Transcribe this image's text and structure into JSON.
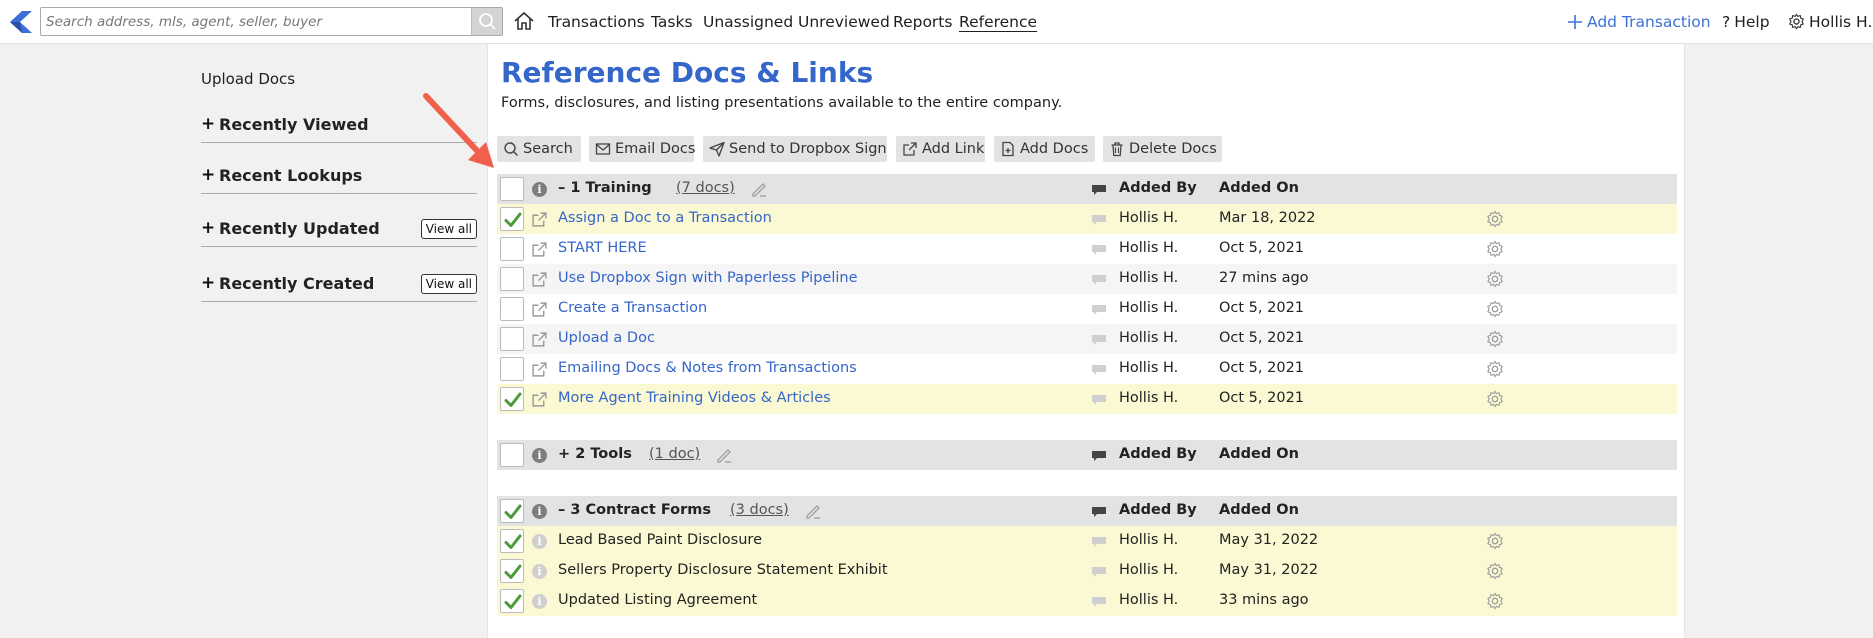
{
  "header": {
    "search_placeholder": "Search address, mls, agent, seller, buyer",
    "nav": [
      {
        "label": "Transactions"
      },
      {
        "label": "Tasks"
      },
      {
        "label": "Unassigned"
      },
      {
        "label": "Unreviewed"
      },
      {
        "label": "Reports"
      },
      {
        "label": "Reference",
        "active": true
      }
    ],
    "add_transaction": "Add Transaction",
    "help": "Help",
    "user": "Hollis H."
  },
  "sidebar": {
    "upload_docs": "Upload Docs",
    "sections": [
      {
        "title": "Recently Viewed",
        "icon": "plus-icon"
      },
      {
        "title": "Recent Lookups",
        "icon": "plus-icon"
      },
      {
        "title": "Recently Updated",
        "icon": "plus-icon",
        "view_all": "View all"
      },
      {
        "title": "Recently Created",
        "icon": "plus-icon",
        "view_all": "View all"
      }
    ]
  },
  "main": {
    "title": "Reference Docs & Links",
    "subtitle": "Forms, disclosures, and listing presentations available to the entire company.",
    "toolbar": [
      {
        "label": "Search",
        "icon": "search-icon"
      },
      {
        "label": "Email Docs",
        "icon": "envelope-icon"
      },
      {
        "label": "Send to Dropbox Sign",
        "icon": "paper-plane-icon"
      },
      {
        "label": "Add Link",
        "icon": "external-link-icon"
      },
      {
        "label": "Add Docs",
        "icon": "add-document-icon"
      },
      {
        "label": "Delete Docs",
        "icon": "trash-icon"
      }
    ],
    "columns": {
      "added_by": "Added By",
      "added_on": "Added On"
    },
    "groups": [
      {
        "name": "1 Training",
        "toggle": "–",
        "count": "(7 docs)",
        "checked": false,
        "docs": [
          {
            "name": "Assign a Doc to a Transaction",
            "by": "Hollis H.",
            "on": "Mar 18, 2022",
            "checked": true,
            "link": true
          },
          {
            "name": "START HERE",
            "by": "Hollis H.",
            "on": "Oct 5, 2021",
            "checked": false,
            "link": true
          },
          {
            "name": "Use Dropbox Sign with Paperless Pipeline",
            "by": "Hollis H.",
            "on": "27 mins ago",
            "checked": false,
            "link": true
          },
          {
            "name": "Create a Transaction",
            "by": "Hollis H.",
            "on": "Oct 5, 2021",
            "checked": false,
            "link": true
          },
          {
            "name": "Upload a Doc",
            "by": "Hollis H.",
            "on": "Oct 5, 2021",
            "checked": false,
            "link": true
          },
          {
            "name": "Emailing Docs & Notes from Transactions",
            "by": "Hollis H.",
            "on": "Oct 5, 2021",
            "checked": false,
            "link": true
          },
          {
            "name": "More Agent Training Videos & Articles",
            "by": "Hollis H.",
            "on": "Oct 5, 2021",
            "checked": true,
            "link": true
          }
        ]
      },
      {
        "name": "2 Tools",
        "toggle": "+",
        "count": "(1 doc)",
        "checked": false,
        "docs": []
      },
      {
        "name": "3 Contract Forms",
        "toggle": "–",
        "count": "(3 docs)",
        "checked": true,
        "docs": [
          {
            "name": "Lead Based Paint Disclosure",
            "by": "Hollis H.",
            "on": "May 31, 2022",
            "checked": true,
            "link": false
          },
          {
            "name": "Sellers Property Disclosure Statement Exhibit",
            "by": "Hollis H.",
            "on": "May 31, 2022",
            "checked": true,
            "link": false
          },
          {
            "name": "Updated Listing Agreement",
            "by": "Hollis H.",
            "on": "33 mins ago",
            "checked": true,
            "link": false
          }
        ]
      }
    ]
  },
  "colors": {
    "accent": "#3566c9",
    "selected_row": "#faf9d3",
    "group_header": "#e3e3e3",
    "arrow": "#f0604a",
    "check": "#4d9a3a"
  }
}
